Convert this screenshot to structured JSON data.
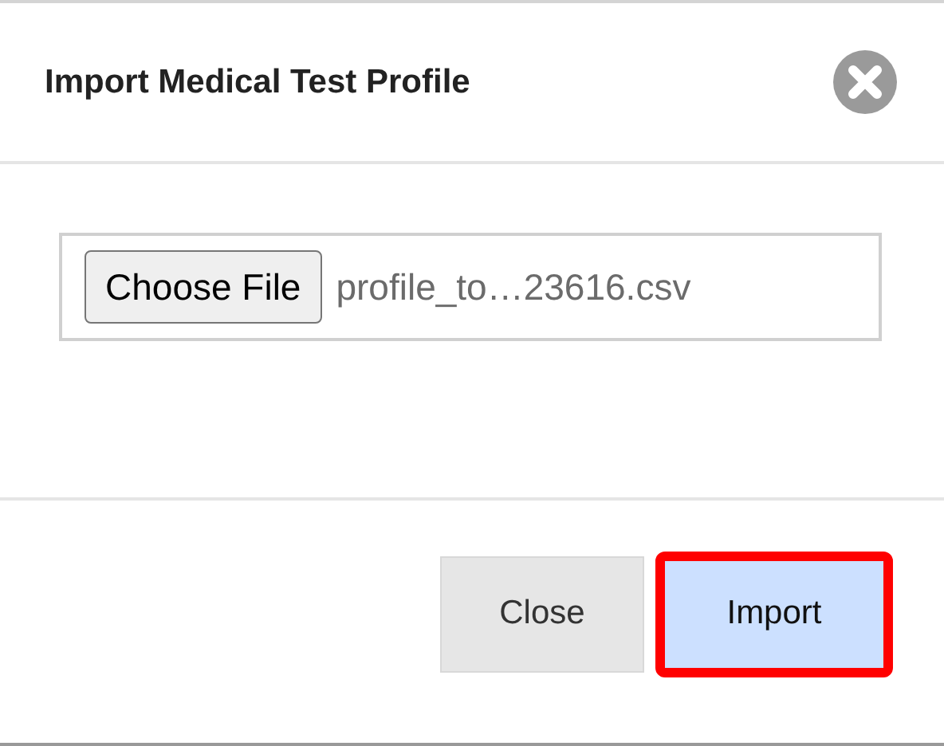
{
  "dialog": {
    "title": "Import Medical Test Profile"
  },
  "file_input": {
    "button_label": "Choose File",
    "filename": "profile_to…23616.csv"
  },
  "buttons": [
    {
      "label": "Close",
      "kind": "secondary",
      "highlighted": false
    },
    {
      "label": "Import",
      "kind": "primary",
      "highlighted": true
    }
  ]
}
